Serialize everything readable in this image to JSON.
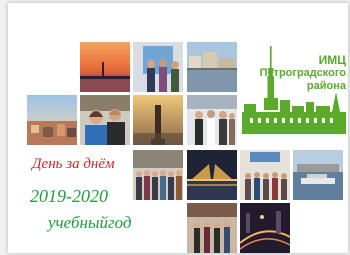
{
  "logo": {
    "line1": "ИМЦ",
    "line2": "Петроградского",
    "line3": "района",
    "color": "#5aaa2c"
  },
  "headline": {
    "day_text": "День за днём",
    "day_color": "#d42727",
    "year_text": "2019-2020",
    "school_year_text": "учебныйгод",
    "year_color": "#1aa13c"
  }
}
